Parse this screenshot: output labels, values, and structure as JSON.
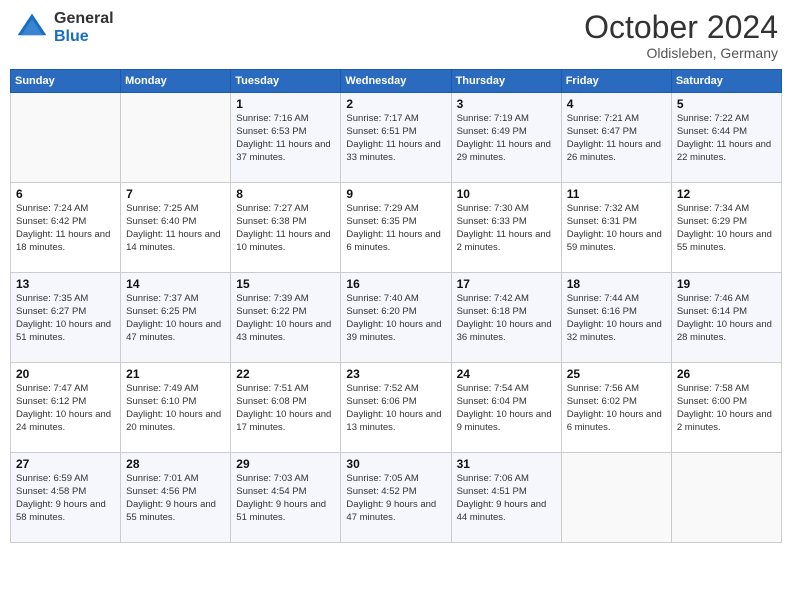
{
  "header": {
    "logo_general": "General",
    "logo_blue": "Blue",
    "month": "October 2024",
    "location": "Oldisleben, Germany"
  },
  "weekdays": [
    "Sunday",
    "Monday",
    "Tuesday",
    "Wednesday",
    "Thursday",
    "Friday",
    "Saturday"
  ],
  "weeks": [
    [
      {
        "day": "",
        "content": ""
      },
      {
        "day": "",
        "content": ""
      },
      {
        "day": "1",
        "content": "Sunrise: 7:16 AM\nSunset: 6:53 PM\nDaylight: 11 hours and 37 minutes."
      },
      {
        "day": "2",
        "content": "Sunrise: 7:17 AM\nSunset: 6:51 PM\nDaylight: 11 hours and 33 minutes."
      },
      {
        "day": "3",
        "content": "Sunrise: 7:19 AM\nSunset: 6:49 PM\nDaylight: 11 hours and 29 minutes."
      },
      {
        "day": "4",
        "content": "Sunrise: 7:21 AM\nSunset: 6:47 PM\nDaylight: 11 hours and 26 minutes."
      },
      {
        "day": "5",
        "content": "Sunrise: 7:22 AM\nSunset: 6:44 PM\nDaylight: 11 hours and 22 minutes."
      }
    ],
    [
      {
        "day": "6",
        "content": "Sunrise: 7:24 AM\nSunset: 6:42 PM\nDaylight: 11 hours and 18 minutes."
      },
      {
        "day": "7",
        "content": "Sunrise: 7:25 AM\nSunset: 6:40 PM\nDaylight: 11 hours and 14 minutes."
      },
      {
        "day": "8",
        "content": "Sunrise: 7:27 AM\nSunset: 6:38 PM\nDaylight: 11 hours and 10 minutes."
      },
      {
        "day": "9",
        "content": "Sunrise: 7:29 AM\nSunset: 6:35 PM\nDaylight: 11 hours and 6 minutes."
      },
      {
        "day": "10",
        "content": "Sunrise: 7:30 AM\nSunset: 6:33 PM\nDaylight: 11 hours and 2 minutes."
      },
      {
        "day": "11",
        "content": "Sunrise: 7:32 AM\nSunset: 6:31 PM\nDaylight: 10 hours and 59 minutes."
      },
      {
        "day": "12",
        "content": "Sunrise: 7:34 AM\nSunset: 6:29 PM\nDaylight: 10 hours and 55 minutes."
      }
    ],
    [
      {
        "day": "13",
        "content": "Sunrise: 7:35 AM\nSunset: 6:27 PM\nDaylight: 10 hours and 51 minutes."
      },
      {
        "day": "14",
        "content": "Sunrise: 7:37 AM\nSunset: 6:25 PM\nDaylight: 10 hours and 47 minutes."
      },
      {
        "day": "15",
        "content": "Sunrise: 7:39 AM\nSunset: 6:22 PM\nDaylight: 10 hours and 43 minutes."
      },
      {
        "day": "16",
        "content": "Sunrise: 7:40 AM\nSunset: 6:20 PM\nDaylight: 10 hours and 39 minutes."
      },
      {
        "day": "17",
        "content": "Sunrise: 7:42 AM\nSunset: 6:18 PM\nDaylight: 10 hours and 36 minutes."
      },
      {
        "day": "18",
        "content": "Sunrise: 7:44 AM\nSunset: 6:16 PM\nDaylight: 10 hours and 32 minutes."
      },
      {
        "day": "19",
        "content": "Sunrise: 7:46 AM\nSunset: 6:14 PM\nDaylight: 10 hours and 28 minutes."
      }
    ],
    [
      {
        "day": "20",
        "content": "Sunrise: 7:47 AM\nSunset: 6:12 PM\nDaylight: 10 hours and 24 minutes."
      },
      {
        "day": "21",
        "content": "Sunrise: 7:49 AM\nSunset: 6:10 PM\nDaylight: 10 hours and 20 minutes."
      },
      {
        "day": "22",
        "content": "Sunrise: 7:51 AM\nSunset: 6:08 PM\nDaylight: 10 hours and 17 minutes."
      },
      {
        "day": "23",
        "content": "Sunrise: 7:52 AM\nSunset: 6:06 PM\nDaylight: 10 hours and 13 minutes."
      },
      {
        "day": "24",
        "content": "Sunrise: 7:54 AM\nSunset: 6:04 PM\nDaylight: 10 hours and 9 minutes."
      },
      {
        "day": "25",
        "content": "Sunrise: 7:56 AM\nSunset: 6:02 PM\nDaylight: 10 hours and 6 minutes."
      },
      {
        "day": "26",
        "content": "Sunrise: 7:58 AM\nSunset: 6:00 PM\nDaylight: 10 hours and 2 minutes."
      }
    ],
    [
      {
        "day": "27",
        "content": "Sunrise: 6:59 AM\nSunset: 4:58 PM\nDaylight: 9 hours and 58 minutes."
      },
      {
        "day": "28",
        "content": "Sunrise: 7:01 AM\nSunset: 4:56 PM\nDaylight: 9 hours and 55 minutes."
      },
      {
        "day": "29",
        "content": "Sunrise: 7:03 AM\nSunset: 4:54 PM\nDaylight: 9 hours and 51 minutes."
      },
      {
        "day": "30",
        "content": "Sunrise: 7:05 AM\nSunset: 4:52 PM\nDaylight: 9 hours and 47 minutes."
      },
      {
        "day": "31",
        "content": "Sunrise: 7:06 AM\nSunset: 4:51 PM\nDaylight: 9 hours and 44 minutes."
      },
      {
        "day": "",
        "content": ""
      },
      {
        "day": "",
        "content": ""
      }
    ]
  ]
}
